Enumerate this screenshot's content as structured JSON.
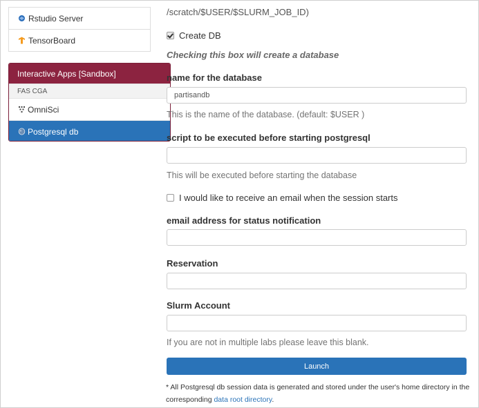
{
  "sidebar": {
    "top_items": [
      {
        "label": "Rstudio Server",
        "icon": "rstudio-icon"
      },
      {
        "label": "TensorBoard",
        "icon": "tensorflow-icon"
      }
    ],
    "panel": {
      "title": "Interactive Apps [Sandbox]",
      "category": "FAS CGA",
      "items": [
        {
          "label": "OmniSci",
          "icon": "omnisci-icon",
          "active": false
        },
        {
          "label": "Postgresql db",
          "icon": "postgres-icon",
          "active": true
        }
      ]
    }
  },
  "form": {
    "path_text": "/scratch/$USER/$SLURM_JOB_ID)",
    "create_db": {
      "label": "Create DB",
      "checked": true
    },
    "create_db_hint": "Checking this box will create a database",
    "db_name": {
      "label": "name for the database",
      "value": "partisandb",
      "help": "This is the name of the database. (default: $USER )"
    },
    "script": {
      "label": "script to be executed before starting postgresql",
      "value": "",
      "help": "This will be executed before starting the database"
    },
    "email_opt": {
      "label": "I would like to receive an email when the session starts",
      "checked": false
    },
    "email": {
      "label": "email address for status notification",
      "value": ""
    },
    "reservation": {
      "label": "Reservation",
      "value": ""
    },
    "slurm_account": {
      "label": "Slurm Account",
      "value": "",
      "help": "If you are not in multiple labs please leave this blank."
    },
    "launch_label": "Launch",
    "note_text": "* All Postgresql db session data is generated and stored under the user's home directory in the corresponding",
    "note_link": "data root directory",
    "note_end": "."
  },
  "colors": {
    "brand": "#8c2340",
    "primary": "#2a73b8"
  }
}
